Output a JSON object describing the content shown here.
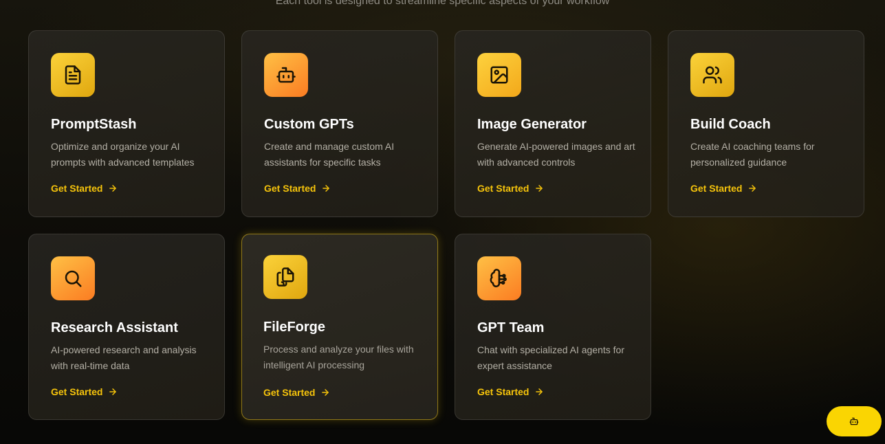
{
  "header": {
    "subtitle": "Each tool is designed to streamline specific aspects of your workflow"
  },
  "tools": [
    {
      "title": "PromptStash",
      "description": "Optimize and organize your AI prompts with advanced templates",
      "cta": "Get Started",
      "icon": "file-text-icon"
    },
    {
      "title": "Custom GPTs",
      "description": "Create and manage custom AI assistants for specific tasks",
      "cta": "Get Started",
      "icon": "bot-icon"
    },
    {
      "title": "Image Generator",
      "description": "Generate AI-powered images and art with advanced controls",
      "cta": "Get Started",
      "icon": "image-icon"
    },
    {
      "title": "Build Coach",
      "description": "Create AI coaching teams for personalized guidance",
      "cta": "Get Started",
      "icon": "users-icon"
    },
    {
      "title": "Research Assistant",
      "description": "AI-powered research and analysis with real-time data",
      "cta": "Get Started",
      "icon": "search-icon"
    },
    {
      "title": "FileForge",
      "description": "Process and analyze your files with intelligent AI processing",
      "cta": "Get Started",
      "icon": "files-icon"
    },
    {
      "title": "GPT Team",
      "description": "Chat with specialized AI agents for expert assistance",
      "cta": "Get Started",
      "icon": "brain-icon"
    }
  ],
  "chat_button": {
    "icon": "bot-icon"
  },
  "colors": {
    "accent": "#f6c40b",
    "card_border": "#2a2824",
    "icon_yellow": "#f2bd20",
    "icon_orange": "#fb8a28",
    "fab": "#fad502"
  }
}
